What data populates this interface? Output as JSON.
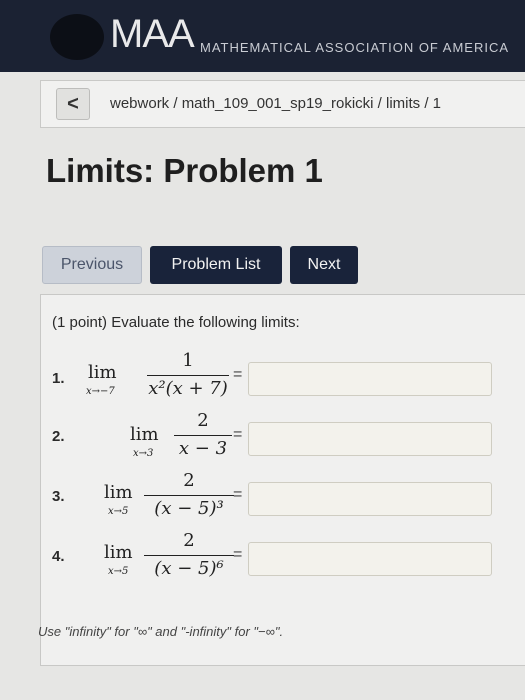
{
  "header": {
    "brand": "MAA",
    "subtitle": "MATHEMATICAL ASSOCIATION OF AMERICA"
  },
  "breadcrumb": {
    "back_label": "<",
    "path": "webwork / math_109_001_sp19_rokicki / limits / 1"
  },
  "page": {
    "title": "Limits: Problem 1"
  },
  "nav": {
    "previous": "Previous",
    "problem_list": "Problem List",
    "next": "Next"
  },
  "problem": {
    "intro": "(1 point) Evaluate the following limits:",
    "items": [
      {
        "number": "1.",
        "lim": "lim",
        "sub": "x→−7",
        "numerator": "1",
        "denominator": "x²(x + 7)",
        "eq": "=",
        "answer": ""
      },
      {
        "number": "2.",
        "lim": "lim",
        "sub": "x→3",
        "numerator": "2",
        "denominator": "x − 3",
        "eq": "=",
        "answer": ""
      },
      {
        "number": "3.",
        "lim": "lim",
        "sub": "x→5",
        "numerator": "2",
        "denominator": "(x − 5)³",
        "eq": "=",
        "answer": ""
      },
      {
        "number": "4.",
        "lim": "lim",
        "sub": "x→5",
        "numerator": "2",
        "denominator": "(x − 5)⁶",
        "eq": "=",
        "answer": ""
      }
    ],
    "note": "Use \"infinity\" for \"∞\" and \"-infinity\" for \"−∞\"."
  },
  "colors": {
    "header_bg": "#1b2233",
    "button_dark": "#19233a",
    "button_light": "#cdd2da"
  }
}
